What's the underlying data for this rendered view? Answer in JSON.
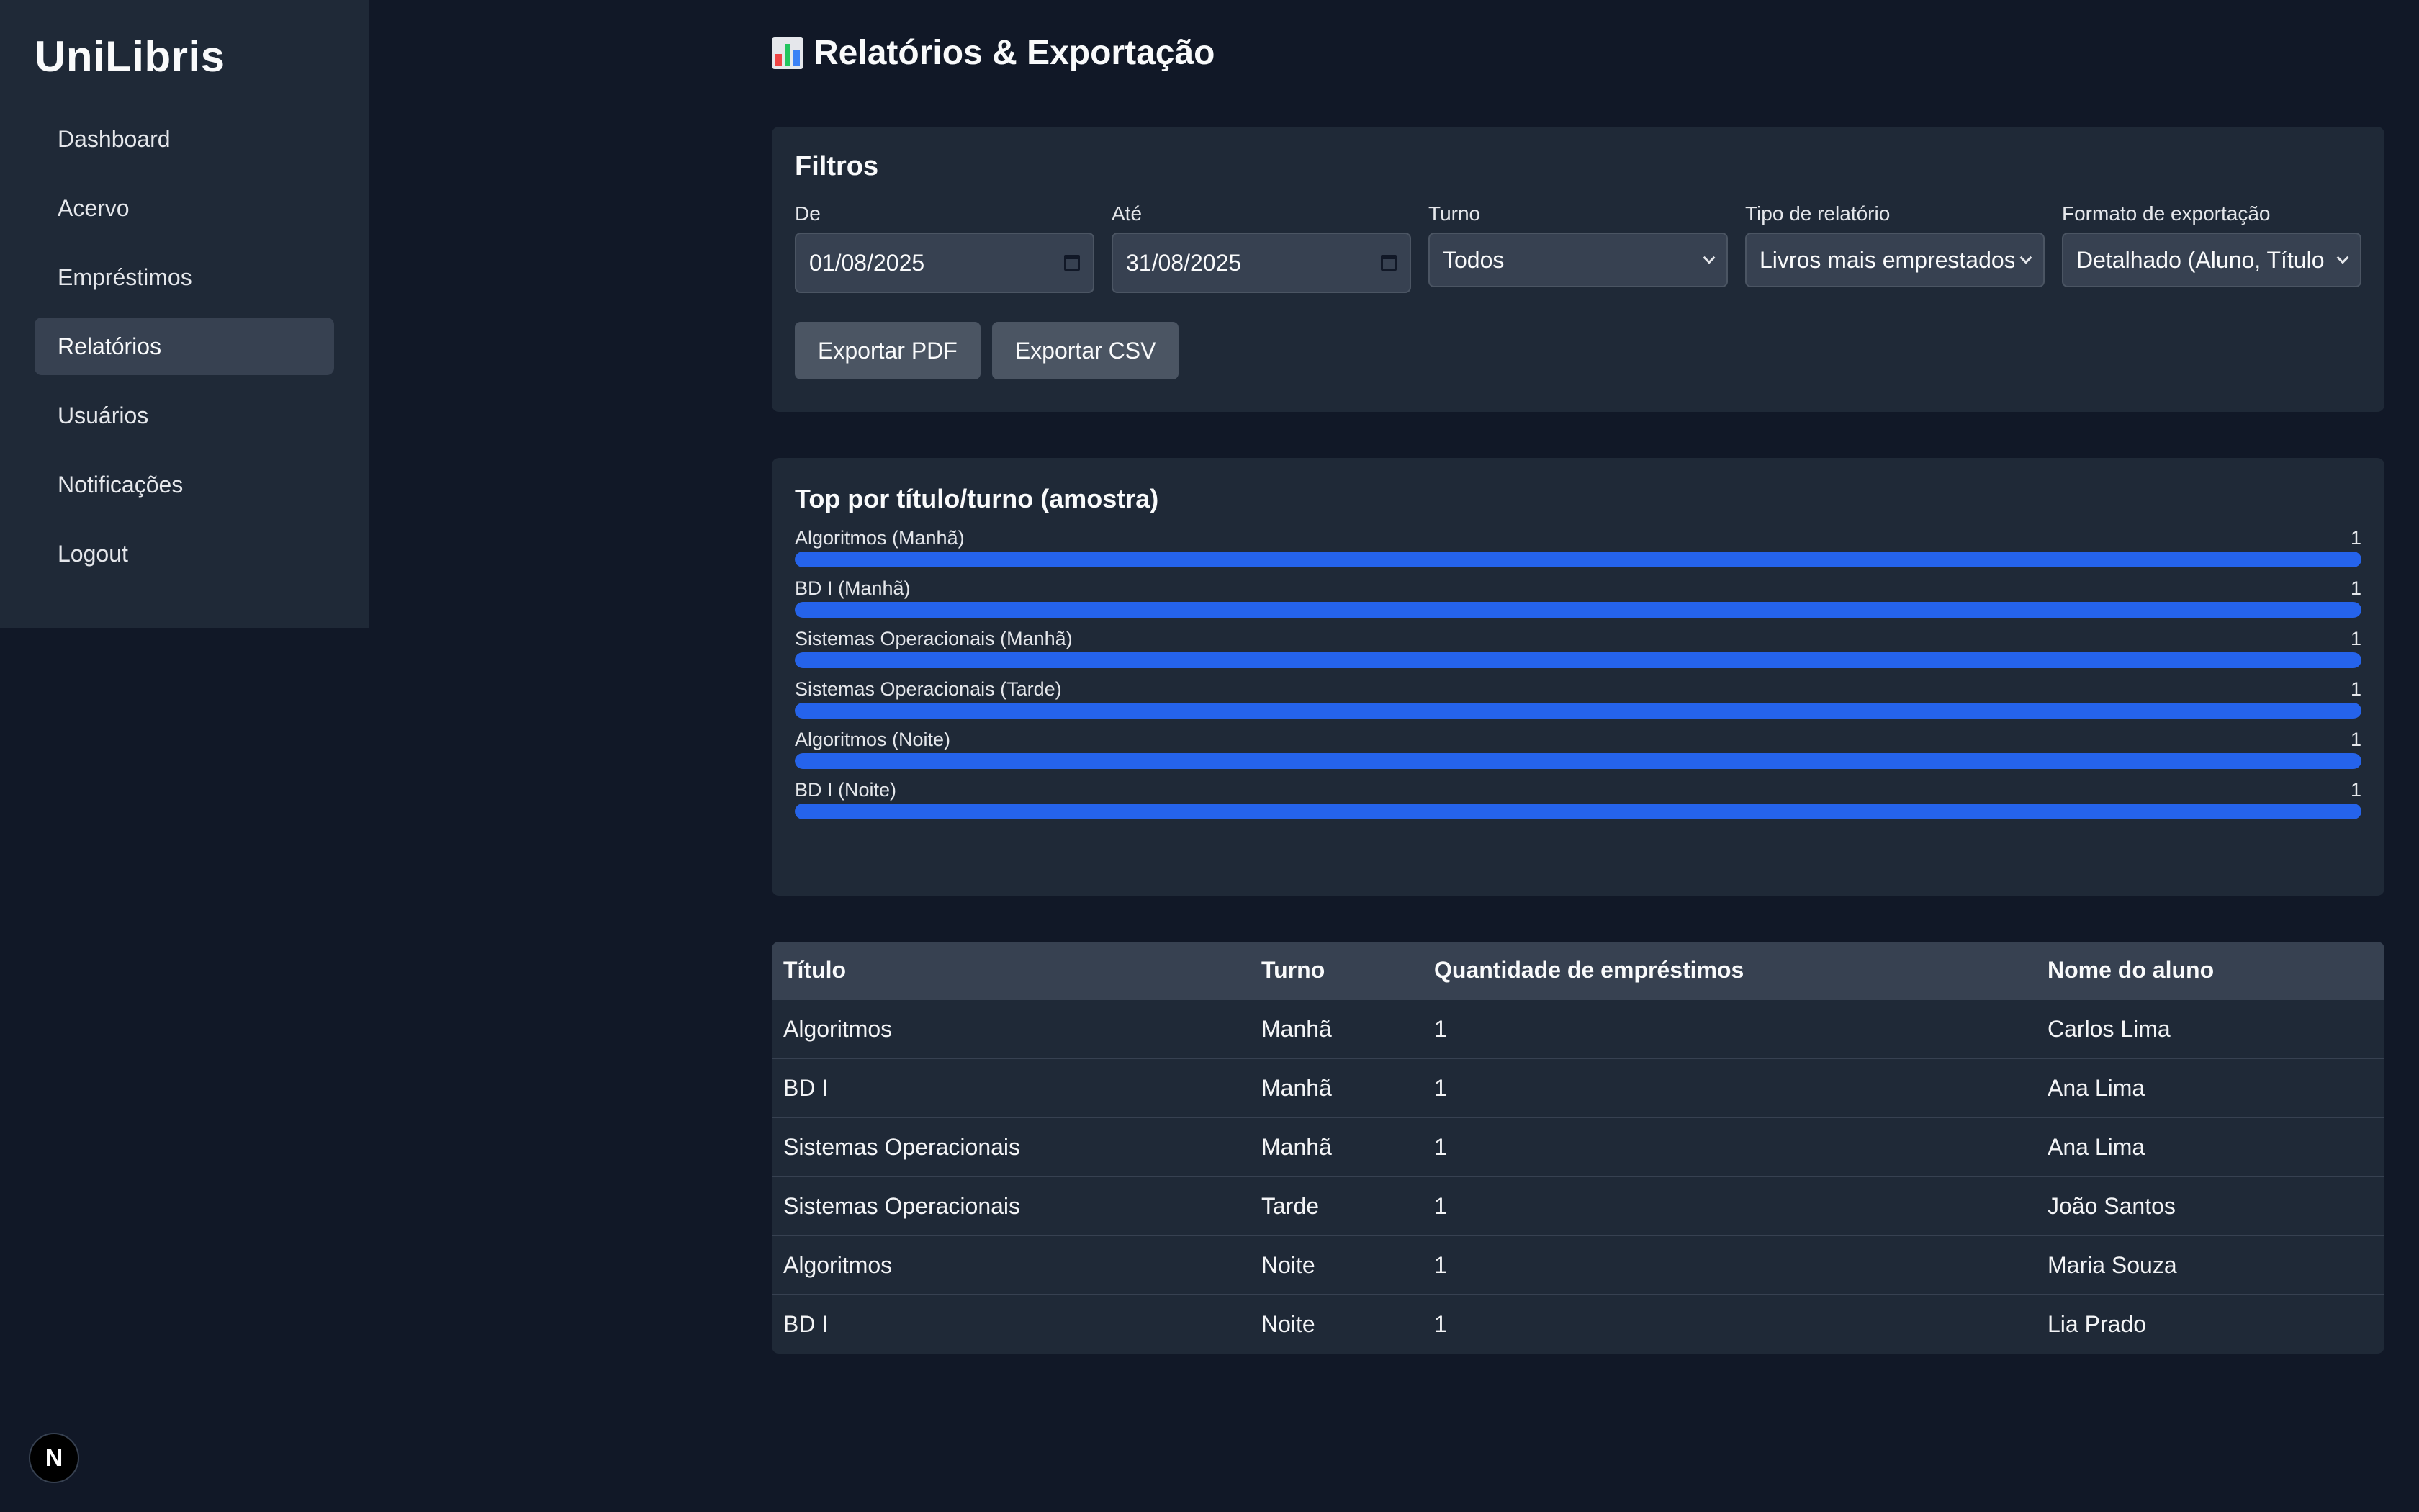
{
  "sidebar": {
    "brand": "UniLibris",
    "items": [
      {
        "label": "Dashboard"
      },
      {
        "label": "Acervo"
      },
      {
        "label": "Empréstimos"
      },
      {
        "label": "Relatórios"
      },
      {
        "label": "Usuários"
      },
      {
        "label": "Notificações"
      },
      {
        "label": "Logout"
      }
    ]
  },
  "header": {
    "title": "Relatórios & Exportação",
    "icon": "bar-chart-icon"
  },
  "filters": {
    "title": "Filtros",
    "from": {
      "label": "De",
      "value": "01/08/2025"
    },
    "to": {
      "label": "Até",
      "value": "31/08/2025"
    },
    "shift": {
      "label": "Turno",
      "value": "Todos"
    },
    "report_type": {
      "label": "Tipo de relatório",
      "value": "Livros mais emprestados"
    },
    "export_format": {
      "label": "Formato de exportação",
      "value": "Detalhado (Aluno, Título"
    },
    "export_pdf": "Exportar PDF",
    "export_csv": "Exportar CSV"
  },
  "chart": {
    "title": "Top por título/turno (amostra)",
    "bars": [
      {
        "label": "Algoritmos (Manhã)",
        "value": "1"
      },
      {
        "label": "BD I (Manhã)",
        "value": "1"
      },
      {
        "label": "Sistemas Operacionais (Manhã)",
        "value": "1"
      },
      {
        "label": "Sistemas Operacionais (Tarde)",
        "value": "1"
      },
      {
        "label": "Algoritmos (Noite)",
        "value": "1"
      },
      {
        "label": "BD I (Noite)",
        "value": "1"
      }
    ]
  },
  "chart_data": {
    "type": "bar",
    "title": "Top por título/turno (amostra)",
    "categories": [
      "Algoritmos (Manhã)",
      "BD I (Manhã)",
      "Sistemas Operacionais (Manhã)",
      "Sistemas Operacionais (Tarde)",
      "Algoritmos (Noite)",
      "BD I (Noite)"
    ],
    "values": [
      1,
      1,
      1,
      1,
      1,
      1
    ],
    "max": 1
  },
  "table": {
    "headers": [
      "Título",
      "Turno",
      "Quantidade de empréstimos",
      "Nome do aluno"
    ],
    "rows": [
      [
        "Algoritmos",
        "Manhã",
        "1",
        "Carlos Lima"
      ],
      [
        "BD I",
        "Manhã",
        "1",
        "Ana Lima"
      ],
      [
        "Sistemas Operacionais",
        "Manhã",
        "1",
        "Ana Lima"
      ],
      [
        "Sistemas Operacionais",
        "Tarde",
        "1",
        "João Santos"
      ],
      [
        "Algoritmos",
        "Noite",
        "1",
        "Maria Souza"
      ],
      [
        "BD I",
        "Noite",
        "1",
        "Lia Prado"
      ]
    ]
  },
  "badge": {
    "label": "N"
  },
  "colors": {
    "bar": "#2563eb",
    "background": "#111827",
    "card": "#1f2937"
  }
}
